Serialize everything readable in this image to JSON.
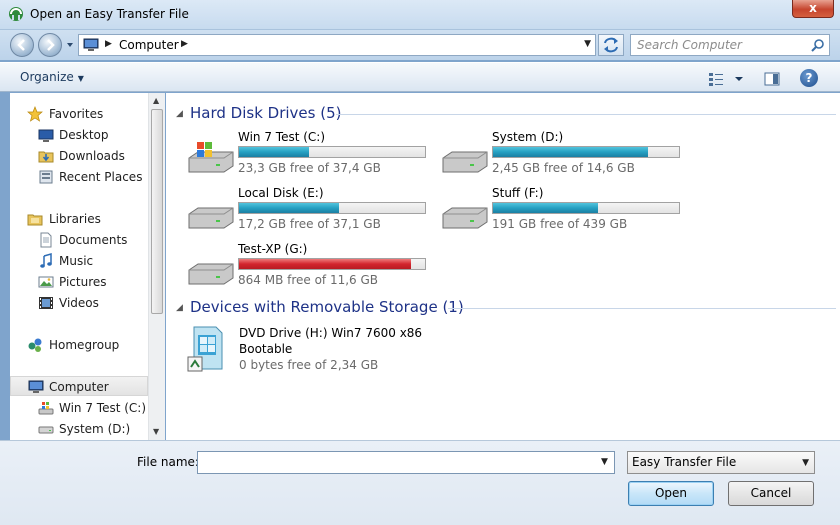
{
  "window": {
    "title": "Open an Easy Transfer File",
    "close_label": "x"
  },
  "address": {
    "path": "Computer",
    "search_placeholder": "Search Computer"
  },
  "toolbar": {
    "organize_label": "Organize",
    "help_label": "?"
  },
  "sidebar": {
    "items": [
      {
        "label": "Favorites",
        "icon": "star-icon"
      },
      {
        "label": "Desktop",
        "icon": "desktop-icon"
      },
      {
        "label": "Downloads",
        "icon": "downloads-folder-icon"
      },
      {
        "label": "Recent Places",
        "icon": "recent-places-icon"
      },
      {
        "label": "Libraries",
        "icon": "libraries-icon"
      },
      {
        "label": "Documents",
        "icon": "documents-icon"
      },
      {
        "label": "Music",
        "icon": "music-icon"
      },
      {
        "label": "Pictures",
        "icon": "pictures-icon"
      },
      {
        "label": "Videos",
        "icon": "videos-icon"
      },
      {
        "label": "Homegroup",
        "icon": "homegroup-icon"
      },
      {
        "label": "Computer",
        "icon": "computer-icon"
      },
      {
        "label": "Win 7 Test (C:)",
        "icon": "windows-drive-icon"
      },
      {
        "label": "System (D:)",
        "icon": "drive-icon"
      }
    ]
  },
  "groups": {
    "hard_disks": {
      "title": "Hard Disk Drives (5)",
      "drives": [
        {
          "name": "Win 7 Test (C:)",
          "free": "23,3 GB free of 37,4 GB",
          "used_fraction": 0.377,
          "status": "normal"
        },
        {
          "name": "System (D:)",
          "free": "2,45 GB free of 14,6 GB",
          "used_fraction": 0.832,
          "status": "normal"
        },
        {
          "name": "Local Disk (E:)",
          "free": "17,2 GB free of 37,1 GB",
          "used_fraction": 0.536,
          "status": "normal"
        },
        {
          "name": "Stuff (F:)",
          "free": "191 GB free of 439 GB",
          "used_fraction": 0.565,
          "status": "normal"
        },
        {
          "name": "Test-XP (G:)",
          "free": "864 MB free of 11,6 GB",
          "used_fraction": 0.927,
          "status": "full"
        }
      ]
    },
    "removable": {
      "title": "Devices with Removable Storage (1)",
      "device": {
        "name": "DVD Drive (H:) Win7 7600 x86",
        "sublabel": "Bootable",
        "free": "0 bytes free of 2,34 GB"
      }
    }
  },
  "bottom": {
    "filename_label": "File name:",
    "filename_value": "",
    "filetype_value": "Easy Transfer File",
    "open_label": "Open",
    "cancel_label": "Cancel"
  },
  "colors": {
    "bar_normal": "#26a0c2",
    "bar_full": "#d3252e",
    "group_title": "#1e3287"
  }
}
